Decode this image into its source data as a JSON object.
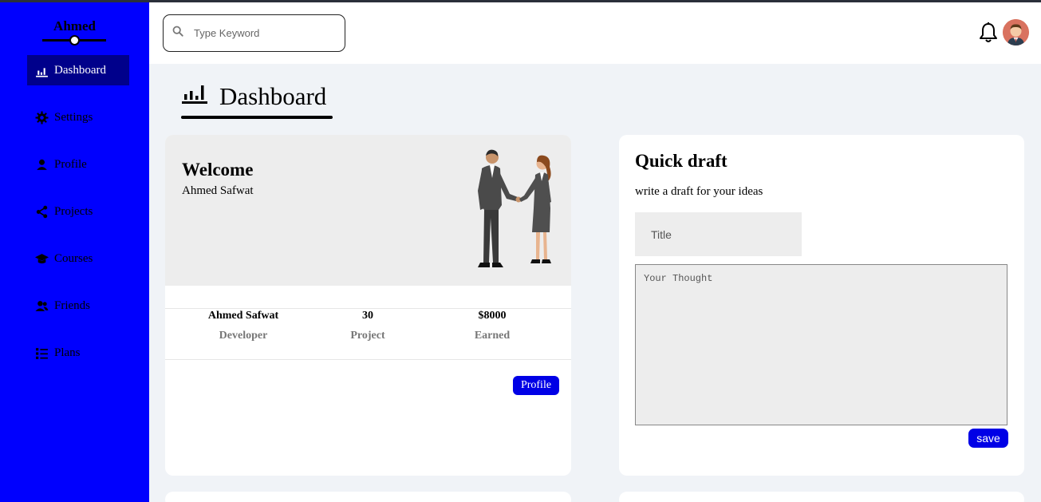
{
  "sidebar": {
    "brand": "Ahmed",
    "items": [
      {
        "label": "Dashboard",
        "icon": "bar-chart-icon"
      },
      {
        "label": "Settings",
        "icon": "gear-icon"
      },
      {
        "label": "Profile",
        "icon": "user-icon"
      },
      {
        "label": "Projects",
        "icon": "share-icon"
      },
      {
        "label": "Courses",
        "icon": "graduation-cap-icon"
      },
      {
        "label": "Friends",
        "icon": "users-icon"
      },
      {
        "label": "Plans",
        "icon": "list-icon"
      }
    ],
    "colors": {
      "background": "#0000fe",
      "active": "#00008b"
    }
  },
  "header": {
    "search_placeholder": "Type Keyword"
  },
  "page": {
    "title": "Dashboard"
  },
  "welcome": {
    "title": "Welcome",
    "name": "Ahmed Safwat",
    "stats": [
      {
        "value": "Ahmed Safwat",
        "label": "Developer"
      },
      {
        "value": "30",
        "label": "Project"
      },
      {
        "value": "$8000",
        "label": "Earned"
      }
    ],
    "profile_button": "Profile"
  },
  "draft": {
    "title": "Quick draft",
    "subtitle": "write a draft for your ideas",
    "title_placeholder": "Title",
    "body_placeholder": "Your Thought",
    "save_button": "save"
  },
  "colors": {
    "accent": "#0000e6",
    "page_bg": "#f0f3f7"
  }
}
